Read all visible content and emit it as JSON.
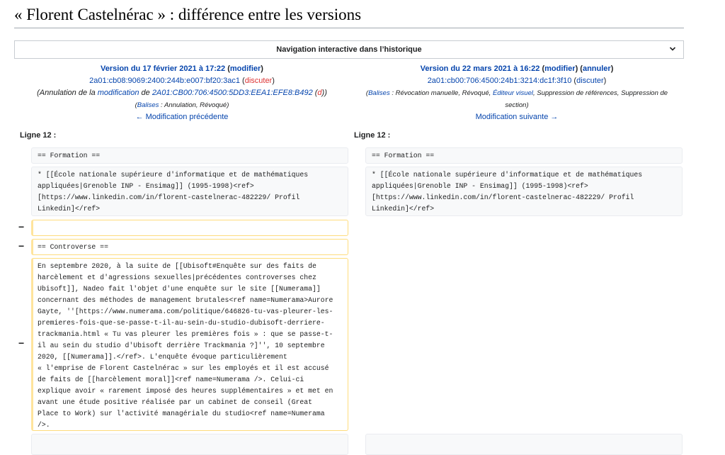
{
  "page": {
    "title": "« Florent Castelnérac » : différence entre les versions"
  },
  "nav": {
    "label": "Navigation interactive dans l’historique",
    "chevron_icon": "chevron-down-icon"
  },
  "left_revision": {
    "version_prefix": "Version du 17 février 2021 à 17:22",
    "open_paren": " (",
    "edit_link": "modifier",
    "close_paren": ")",
    "user": "2a01:cb08:9069:2400:244b:e007:bf20:3ac1",
    "talk_open": " (",
    "talk_link": "discuter",
    "talk_close": ")",
    "summary_before": "(Annulation de la ",
    "summary_link": "modification",
    "summary_mid": " de ",
    "summary_user": "2A01:CB00:706:4500:5DD3:EEA1:EFE8:B492",
    "summary_user_open": " (",
    "summary_user_talk": "d",
    "summary_after": "))",
    "tags_open": "(",
    "tags_link": "Balises",
    "tags_text": " : Annulation, Révoqué)",
    "prev_link": "← Modification précédente"
  },
  "right_revision": {
    "version_prefix": "Version du 22 mars 2021 à 16:22",
    "open_paren": " (",
    "edit_link": "modifier",
    "mid_paren": ") (",
    "undo_link": "annuler",
    "close_paren": ")",
    "user": "2a01:cb00:706:4500:24b1:3214:dc1f:3f10",
    "talk_open": " (",
    "talk_link": "discuter",
    "talk_close": ")",
    "tags_open": "(",
    "tags_link": "Balises",
    "tags_text_1": " : Révocation manuelle, Révoqué, ",
    "tags_link_2": "Éditeur visuel",
    "tags_text_2": ", Suppression de références, Suppression de",
    "tags_text_3": "section)",
    "next_link": "Modification suivante →"
  },
  "diff": {
    "left_line_label": "Ligne 12 :",
    "right_line_label": "Ligne 12 :",
    "minus": "−",
    "ctx_formation": "== Formation ==",
    "ctx_school": "* [[École nationale supérieure d'informatique et de mathématiques\nappliquées|Grenoble INP - Ensimag]] (1995-1998)<ref>\n[https://www.linkedin.com/in/florent-castelnerac-482229/ Profil\nLinkedin]</ref>",
    "del_blank": "",
    "del_controverse": "== Controverse ==",
    "del_paragraph": "En septembre 2020, à la suite de [[Ubisoft#Enquête sur des faits de\nharcèlement et d'agressions sexuelles|précédentes controverses chez\nUbisoft]], Nadeo fait l'objet d'une enquête sur le site [[Numerama]]\nconcernant des méthodes de management brutales<ref name=Numerama>Aurore\nGayte, ''[https://www.numerama.com/politique/646826-tu-vas-pleurer-les-\npremieres-fois-que-se-passe-t-il-au-sein-du-studio-dubisoft-derriere-\ntrackmania.html « Tu vas pleurer les premières fois » : que se passe-t-\nil au sein du studio d'Ubisoft derrière Trackmania ?]'', 10 septembre\n2020, [[Numerama]].</ref>. L'enquête évoque particulièrement\n« l'emprise de Florent Castelnérac » sur les employés et il est accusé\nde faits de [[harcèlement moral]]<ref name=Numerama />. Celui-ci\nexplique avoir « rarement imposé des heures supplémentaires » et met en\navant une étude positive réalisée par un cabinet de conseil (Great\nPlace to Work) sur l'activité managériale du studio<ref name=Numerama\n/>."
  }
}
